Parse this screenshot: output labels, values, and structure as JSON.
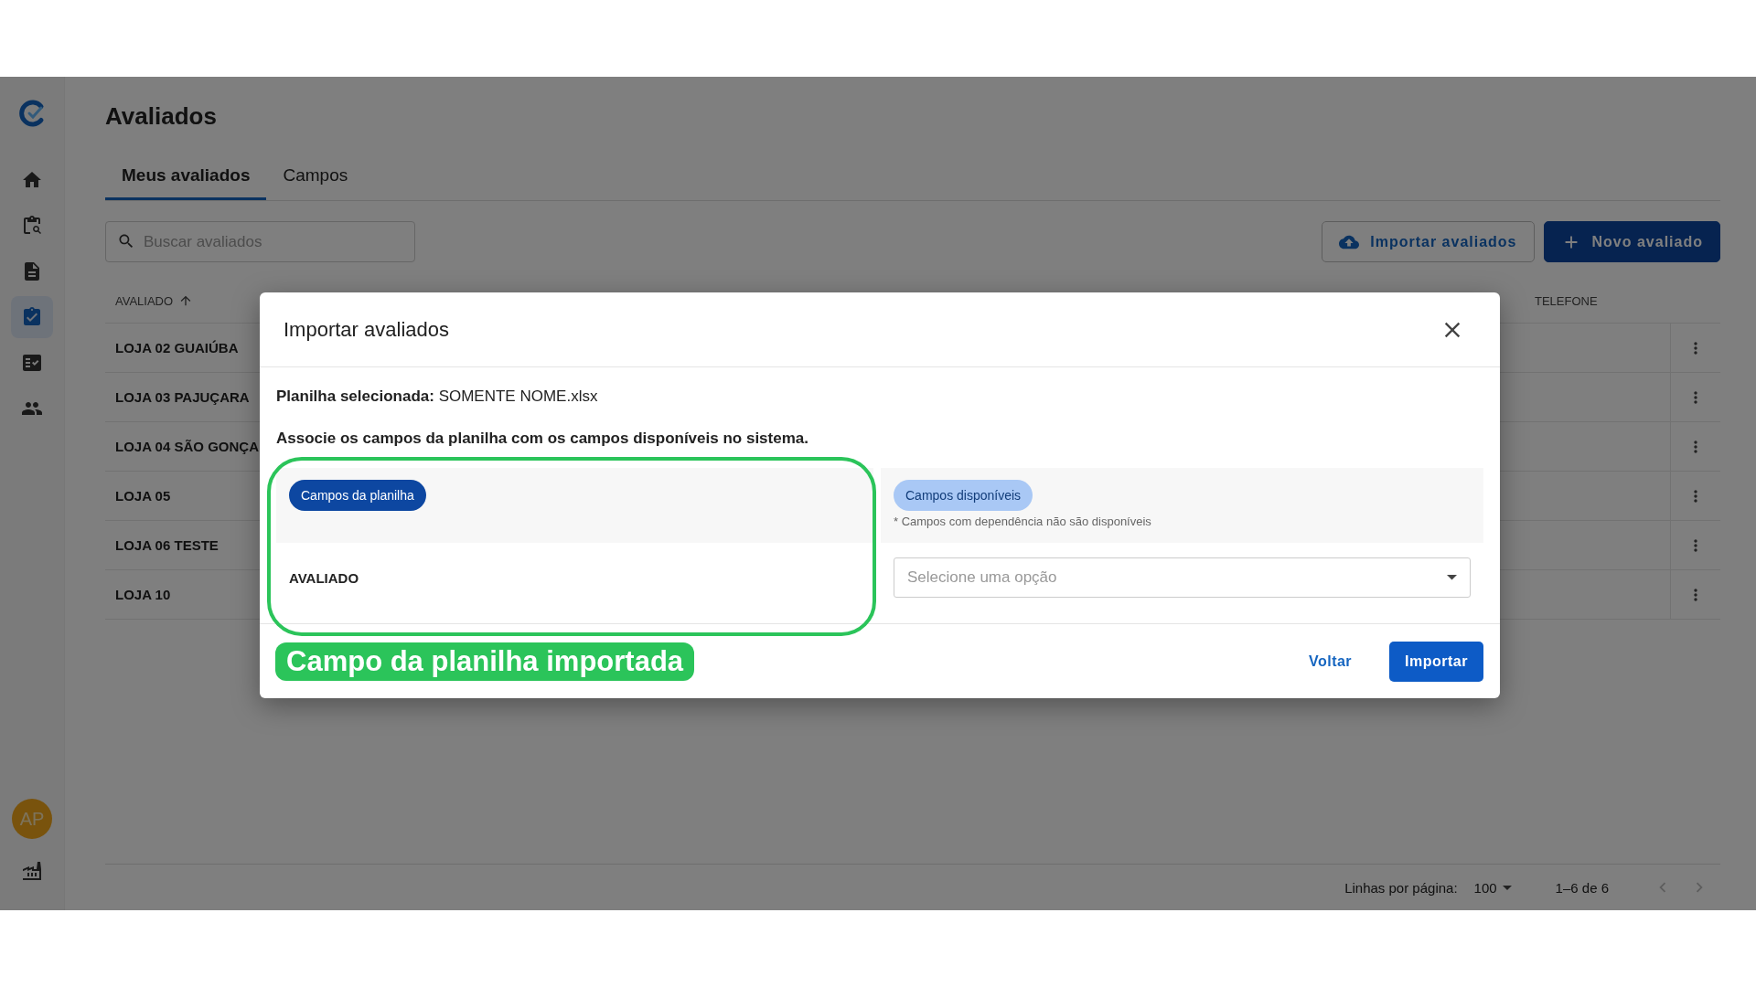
{
  "sidebar": {
    "items": [
      {
        "kind": "home",
        "selected": false
      },
      {
        "kind": "clipboard-search",
        "selected": false
      },
      {
        "kind": "document",
        "selected": false
      },
      {
        "kind": "clipboard-check",
        "selected": true
      },
      {
        "kind": "checklist",
        "selected": false
      },
      {
        "kind": "people",
        "selected": false
      }
    ],
    "avatar": {
      "initials": "AP"
    },
    "bottom_items": [
      {
        "kind": "factory"
      }
    ]
  },
  "page": {
    "title": "Avaliados"
  },
  "tabs": [
    {
      "label": "Meus avaliados",
      "selected": true
    },
    {
      "label": "Campos",
      "selected": false
    }
  ],
  "search": {
    "placeholder": "Buscar avaliados"
  },
  "actions": [
    {
      "label": "Importar avaliados",
      "kind": "outlined"
    },
    {
      "label": "Novo avaliado",
      "kind": "filled"
    }
  ],
  "table": {
    "columns": [
      {
        "label": "AVALIADO",
        "sorted": true
      },
      {
        "label": "TELEFONE",
        "sorted": false
      }
    ],
    "rows": [
      {
        "avaliado": "LOJA 02 GUAIÚBA"
      },
      {
        "avaliado": "LOJA 03 PAJUÇARA"
      },
      {
        "avaliado": "LOJA 04 SÃO GONÇA"
      },
      {
        "avaliado": "LOJA 05"
      },
      {
        "avaliado": "LOJA 06 TESTE"
      },
      {
        "avaliado": "LOJA 10"
      }
    ]
  },
  "pagination": {
    "rows_label": "Linhas por página:",
    "rows_per_page": "100",
    "range": "1–6 de 6"
  },
  "dialog": {
    "title": "Importar avaliados",
    "file_line": "**Planilha selecionada:** SOMENTE NOME.xlsx",
    "instruction": "Associe os campos da planilha com os campos disponíveis no sistema.",
    "left_header": "Campos da planilha",
    "right_header": "Campos disponíveis",
    "note": "* Campos com dependência não são disponíveis",
    "mappings": [
      {
        "field": "AVALIADO",
        "placeholder": "Selecione uma opção"
      }
    ],
    "buttons": [
      {
        "label": "Voltar",
        "kind": "text"
      },
      {
        "label": "Importar",
        "kind": "filled"
      }
    ],
    "annotation": {
      "label": "Campo da planilha importada"
    }
  }
}
